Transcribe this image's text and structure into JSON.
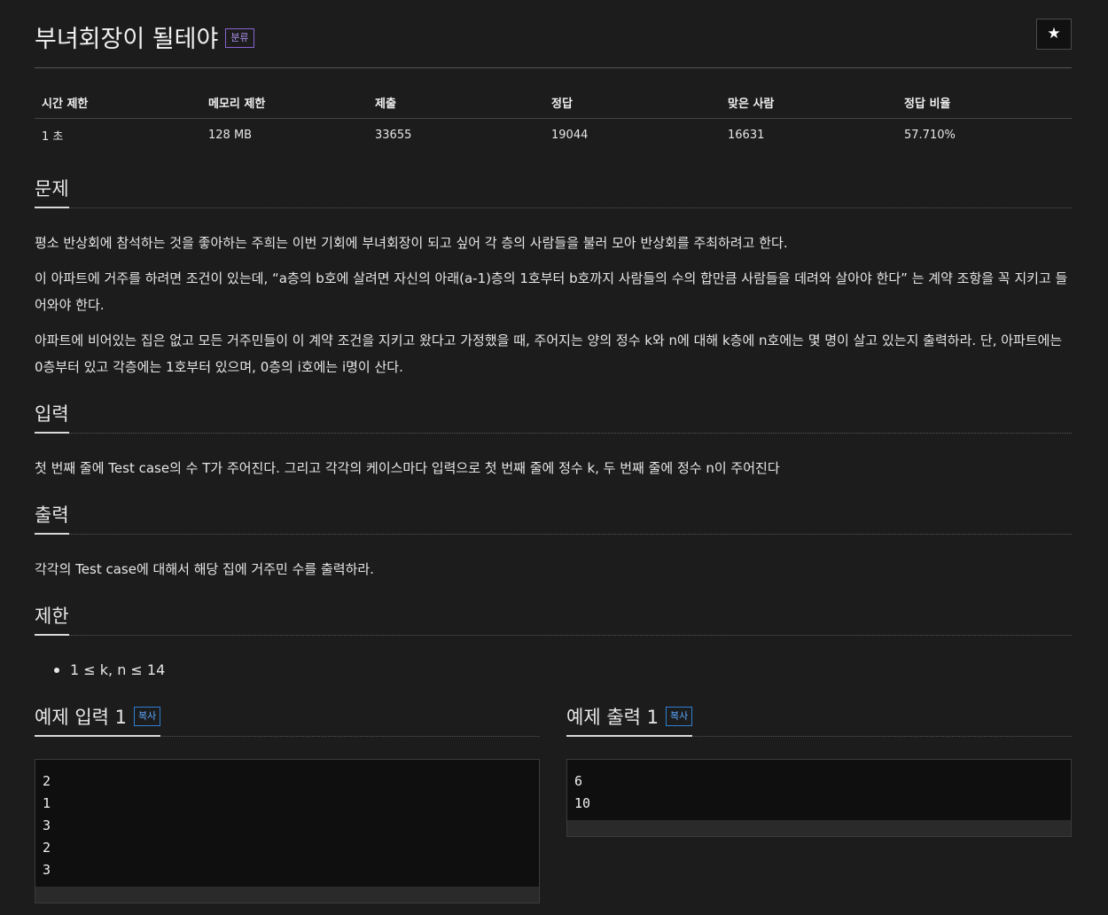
{
  "problem": {
    "title": "부녀회장이 될테야",
    "category_badge": "분류",
    "star_icon": "★"
  },
  "info_table": {
    "headers": [
      "시간 제한",
      "메모리 제한",
      "제출",
      "정답",
      "맞은 사람",
      "정답 비율"
    ],
    "values": [
      "1 초",
      "128 MB",
      "33655",
      "19044",
      "16631",
      "57.710%"
    ]
  },
  "sections": {
    "description": {
      "heading": "문제",
      "paragraphs": [
        "평소 반상회에 참석하는 것을 좋아하는 주희는 이번 기회에 부녀회장이 되고 싶어 각 층의 사람들을 불러 모아 반상회를 주최하려고 한다.",
        "이 아파트에 거주를 하려면 조건이 있는데, “a층의 b호에 살려면 자신의 아래(a-1)층의 1호부터 b호까지 사람들의 수의 합만큼 사람들을 데려와 살아야 한다” 는 계약 조항을 꼭 지키고 들어와야 한다.",
        "아파트에 비어있는 집은 없고 모든 거주민들이 이 계약 조건을 지키고 왔다고 가정했을 때, 주어지는 양의 정수 k와 n에 대해 k층에 n호에는 몇 명이 살고 있는지 출력하라. 단, 아파트에는 0층부터 있고 각층에는 1호부터 있으며, 0층의 i호에는 i명이 산다."
      ]
    },
    "input": {
      "heading": "입력",
      "text": "첫 번째 줄에 Test case의 수 T가 주어진다. 그리고 각각의 케이스마다 입력으로 첫 번째 줄에 정수 k, 두 번째 줄에 정수 n이 주어진다"
    },
    "output": {
      "heading": "출력",
      "text": "각각의 Test case에 대해서 해당 집에 거주민 수를 출력하라."
    },
    "limits": {
      "heading": "제한",
      "items": [
        "1 ≤ k, n ≤ 14"
      ]
    }
  },
  "samples": {
    "input": {
      "heading": "예제 입력 1",
      "copy_label": "복사",
      "code": "2\n1\n3\n2\n3"
    },
    "output": {
      "heading": "예제 출력 1",
      "copy_label": "복사",
      "code": "6\n10"
    }
  },
  "colors": {
    "background": "#1c1c1c",
    "category_badge": "#8a63d2",
    "copy_badge": "#2f7fd0"
  }
}
